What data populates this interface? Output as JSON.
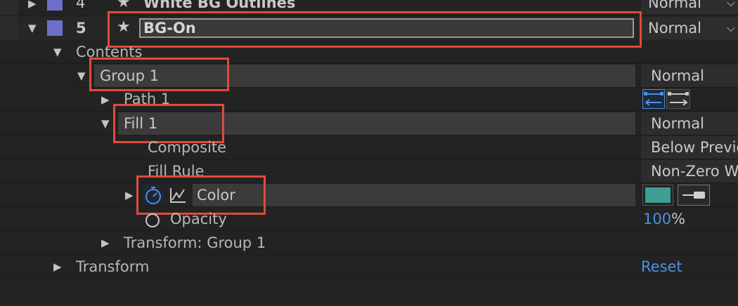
{
  "layers": [
    {
      "index": "4",
      "name": "White BG Outlines",
      "mode": "Normal"
    },
    {
      "index": "5",
      "name": "BG-On",
      "mode": "Normal"
    }
  ],
  "tree": {
    "contents": "Contents",
    "group1": {
      "label": "Group 1",
      "mode": "Normal"
    },
    "path1": "Path 1",
    "fill1": {
      "label": "Fill 1",
      "mode": "Normal"
    },
    "composite": {
      "label": "Composite",
      "value": "Below Previo"
    },
    "fill_rule": {
      "label": "Fill Rule",
      "value": "Non-Zero W"
    },
    "color": {
      "label": "Color",
      "swatch": "#3f9e96"
    },
    "opacity": {
      "label": "Opacity",
      "value": "100",
      "unit": "%"
    },
    "transform_group": "Transform: Group 1",
    "transform": "Transform",
    "reset": "Reset"
  },
  "colors": {
    "highlight": "#e04b3c",
    "accent": "#4a90e2",
    "label_swatch": "#6c70c9"
  },
  "icons": [
    "triangle-right-icon",
    "triangle-down-icon",
    "star-icon",
    "chevron-down-icon",
    "stopwatch-icon",
    "graph-icon",
    "path-direction-icon",
    "eyedropper-icon"
  ]
}
